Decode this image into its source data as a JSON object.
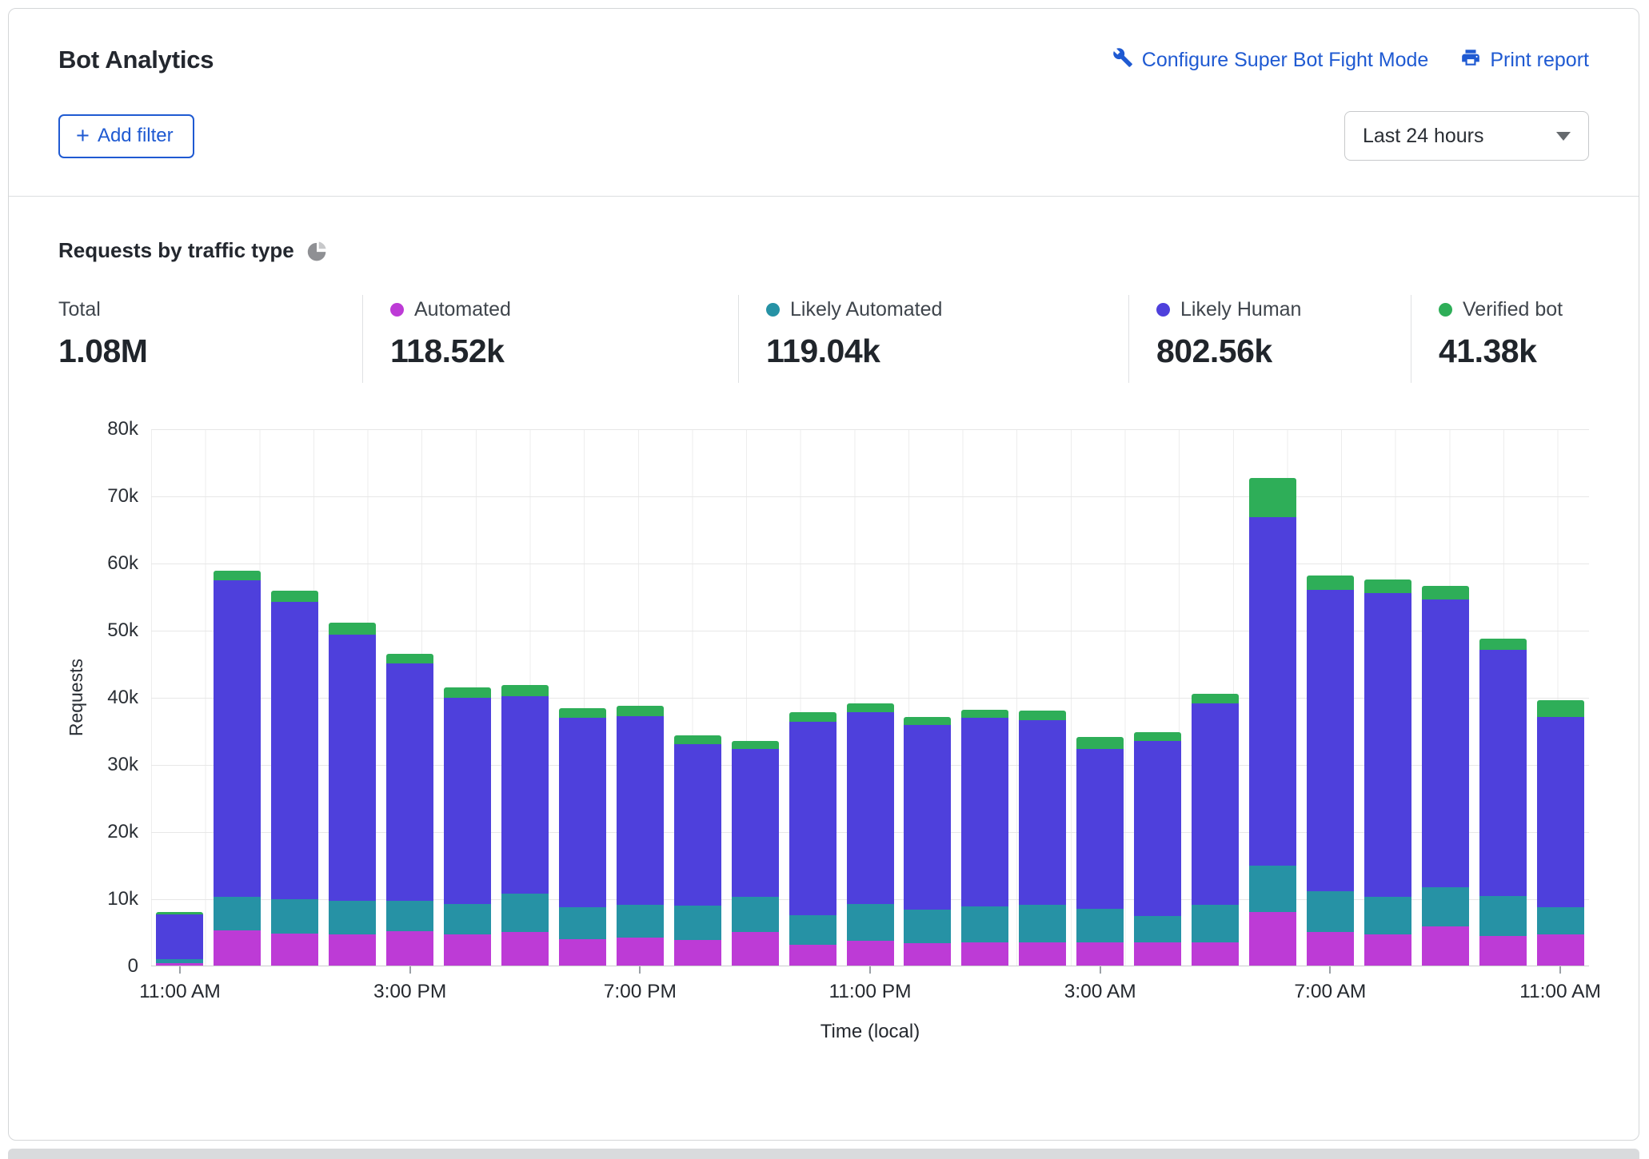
{
  "header": {
    "title": "Bot Analytics",
    "configure_link": "Configure Super Bot Fight Mode",
    "print_link": "Print report"
  },
  "toolbar": {
    "add_filter_label": "Add filter",
    "time_range_value": "Last 24 hours"
  },
  "section": {
    "title": "Requests by traffic type"
  },
  "stats": [
    {
      "label": "Total",
      "value": "1.08M",
      "color": ""
    },
    {
      "label": "Automated",
      "value": "118.52k",
      "color": "#bd3bd6"
    },
    {
      "label": "Likely Automated",
      "value": "119.04k",
      "color": "#2692a5"
    },
    {
      "label": "Likely Human",
      "value": "802.56k",
      "color": "#4e40dc"
    },
    {
      "label": "Verified bot",
      "value": "41.38k",
      "color": "#2eae58"
    }
  ],
  "colors": {
    "link_blue": "#1f5ad2",
    "automated": "#bd3bd6",
    "likely_automated": "#2692a5",
    "likely_human": "#4e40dc",
    "verified_bot": "#2eae58",
    "gridline": "#e7e7e7"
  },
  "chart_data": {
    "type": "bar",
    "stacked": true,
    "title": "Requests by traffic type",
    "xlabel": "Time (local)",
    "ylabel": "Requests",
    "unit": "thousands of requests (values_k are in k)",
    "ylim": [
      0,
      80000
    ],
    "y_ticks": [
      "80k",
      "70k",
      "60k",
      "50k",
      "40k",
      "30k",
      "20k",
      "10k",
      "0"
    ],
    "x_tick_labels": [
      "11:00 AM",
      "3:00 PM",
      "7:00 PM",
      "11:00 PM",
      "3:00 AM",
      "7:00 AM",
      "11:00 AM"
    ],
    "x_tick_indices": [
      0,
      4,
      8,
      12,
      16,
      20,
      24
    ],
    "grid": true,
    "legend_position": "top-stats-row",
    "categories": [
      "11:00 AM",
      "12:00 PM",
      "1:00 PM",
      "2:00 PM",
      "3:00 PM",
      "4:00 PM",
      "5:00 PM",
      "6:00 PM",
      "7:00 PM",
      "8:00 PM",
      "9:00 PM",
      "10:00 PM",
      "11:00 PM",
      "12:00 AM",
      "1:00 AM",
      "2:00 AM",
      "3:00 AM",
      "4:00 AM",
      "5:00 AM",
      "6:00 AM",
      "7:00 AM",
      "8:00 AM",
      "9:00 AM",
      "10:00 AM",
      "11:00 AM"
    ],
    "series": [
      {
        "key": "automated",
        "name": "Automated",
        "color": "#bd3bd6",
        "values_k": [
          0.4,
          5.2,
          4.8,
          4.6,
          5.1,
          4.6,
          5.0,
          3.9,
          4.2,
          3.8,
          5.0,
          3.1,
          3.7,
          3.3,
          3.5,
          3.5,
          3.5,
          3.5,
          3.5,
          8.0,
          5.0,
          4.6,
          5.8,
          4.4,
          4.6
        ]
      },
      {
        "key": "likely_automated",
        "name": "Likely Automated",
        "color": "#2692a5",
        "values_k": [
          0.6,
          5.0,
          5.1,
          5.0,
          4.5,
          4.6,
          5.7,
          4.8,
          4.8,
          5.1,
          5.2,
          4.4,
          5.5,
          5.0,
          5.3,
          5.5,
          5.0,
          3.9,
          5.5,
          6.9,
          6.1,
          5.6,
          5.9,
          6.0,
          4.1
        ]
      },
      {
        "key": "likely_human",
        "name": "Likely Human",
        "color": "#4e40dc",
        "values_k": [
          6.6,
          47.2,
          44.3,
          39.7,
          35.4,
          30.7,
          29.4,
          28.2,
          28.1,
          24.1,
          22.1,
          28.8,
          28.5,
          27.5,
          28.1,
          27.6,
          23.8,
          26.0,
          30.1,
          51.9,
          44.9,
          45.3,
          42.8,
          36.6,
          28.3
        ]
      },
      {
        "key": "verified_bot",
        "name": "Verified bot",
        "color": "#2eae58",
        "values_k": [
          0.4,
          1.4,
          1.6,
          1.8,
          1.4,
          1.5,
          1.7,
          1.4,
          1.6,
          1.3,
          1.2,
          1.4,
          1.3,
          1.2,
          1.2,
          1.4,
          1.8,
          1.4,
          1.4,
          5.8,
          2.1,
          2.0,
          2.0,
          1.7,
          2.5
        ]
      }
    ]
  }
}
